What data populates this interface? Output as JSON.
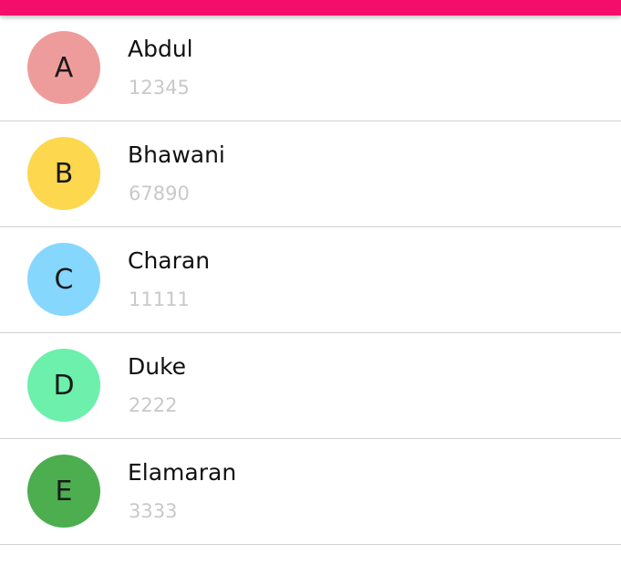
{
  "theme": {
    "accent": "#f50d6b",
    "divider": "#d2d2d2"
  },
  "contacts": [
    {
      "initial": "A",
      "name": "Abdul",
      "number": "12345",
      "color": "#ee9c9b"
    },
    {
      "initial": "B",
      "name": "Bhawani",
      "number": "67890",
      "color": "#fdd74e"
    },
    {
      "initial": "C",
      "name": "Charan",
      "number": "11111",
      "color": "#85d7fd"
    },
    {
      "initial": "D",
      "name": "Duke",
      "number": "2222",
      "color": "#6cf0ab"
    },
    {
      "initial": "E",
      "name": "Elamaran",
      "number": "3333",
      "color": "#4cae4f"
    }
  ]
}
